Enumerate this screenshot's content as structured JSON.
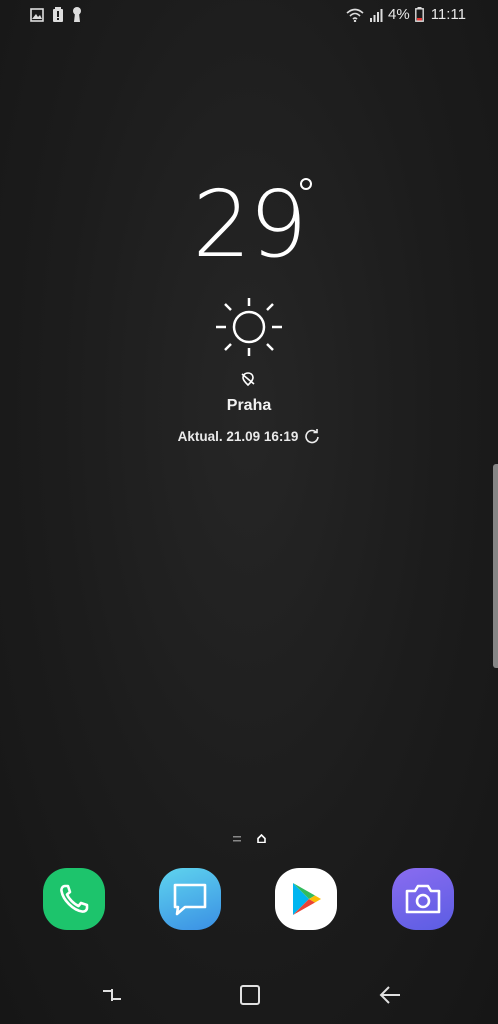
{
  "status_bar": {
    "battery_percent": "4%",
    "time": "11:11",
    "left_icons": [
      "gallery-icon",
      "battery-alert-icon",
      "keyhole-icon"
    ],
    "right_icons": [
      "wifi-icon",
      "signal-icon",
      "battery-icon"
    ]
  },
  "weather": {
    "temperature": "29",
    "condition_icon": "sun-icon",
    "location_icon": "location-off-icon",
    "city": "Praha",
    "updated": "Aktual. 21.09 16:19",
    "refresh_icon": "refresh-icon"
  },
  "home": {
    "page_indicators": [
      "menu-page-icon",
      "home-page-icon"
    ]
  },
  "dock": {
    "apps": [
      {
        "name": "phone",
        "icon": "phone-icon",
        "color": "#1dc46c"
      },
      {
        "name": "messages",
        "icon": "messages-icon",
        "color": "#3aa7e6"
      },
      {
        "name": "play-store",
        "icon": "play-store-icon",
        "color": "#ffffff"
      },
      {
        "name": "camera",
        "icon": "camera-icon",
        "color": "#6d63e8"
      }
    ]
  },
  "nav_bar": {
    "buttons": [
      "recents-icon",
      "home-icon",
      "back-icon"
    ]
  }
}
